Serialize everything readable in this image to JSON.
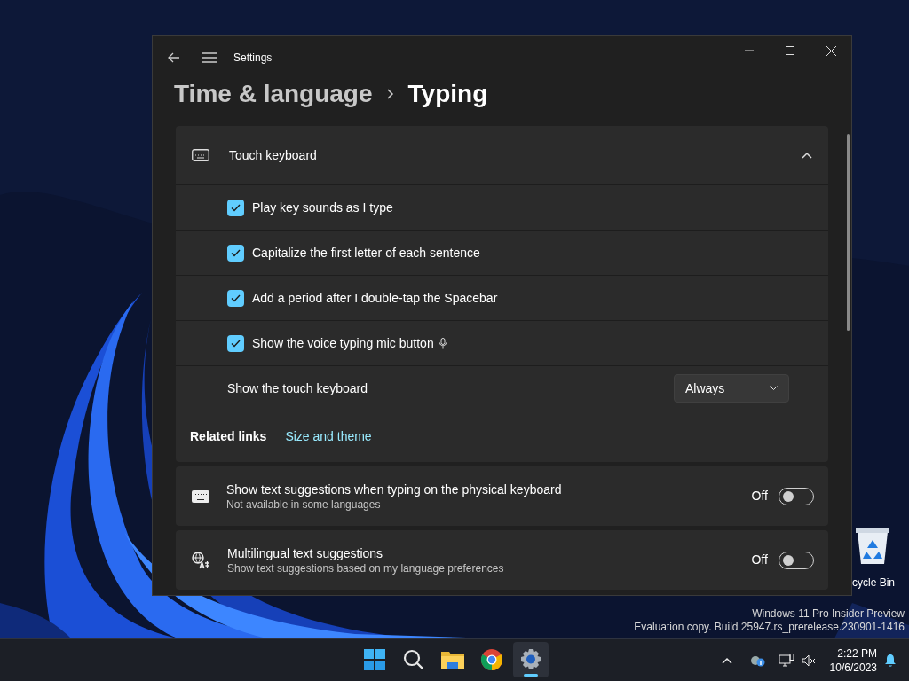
{
  "window": {
    "title": "Settings"
  },
  "breadcrumb": {
    "parent": "Time & language",
    "current": "Typing"
  },
  "touch_keyboard": {
    "title": "Touch keyboard",
    "expanded": true,
    "options": [
      {
        "kind": "checkbox",
        "label": "Play key sounds as I type",
        "checked": true
      },
      {
        "kind": "checkbox",
        "label": "Capitalize the first letter of each sentence",
        "checked": true
      },
      {
        "kind": "checkbox",
        "label": "Add a period after I double-tap the Spacebar",
        "checked": true
      },
      {
        "kind": "mic-checkbox",
        "label": "Show the voice typing mic button",
        "checked": true
      },
      {
        "kind": "dropdown",
        "label": "Show the touch keyboard",
        "value": "Always"
      }
    ],
    "related_links": {
      "label": "Related links",
      "links": [
        "Size and theme"
      ]
    }
  },
  "settings": [
    {
      "kind": "keyboard",
      "title": "Show text suggestions when typing on the physical keyboard",
      "description": "Not available in some languages",
      "state_label": "Off",
      "on": false
    },
    {
      "kind": "translate",
      "title": "Multilingual text suggestions",
      "description": "Show text suggestions based on my language preferences",
      "state_label": "Off",
      "on": false
    }
  ],
  "desktop": {
    "recycle_bin": "cycle Bin",
    "watermark": [
      "Windows 11 Pro Insider Preview",
      "Evaluation copy. Build 25947.rs_prerelease.230901-1416"
    ]
  },
  "taskbar": {
    "apps": [
      {
        "kind": "start",
        "selected": false
      },
      {
        "kind": "search",
        "selected": false
      },
      {
        "kind": "folder",
        "selected": false
      },
      {
        "kind": "browser",
        "selected": false
      },
      {
        "kind": "settings",
        "selected": true
      }
    ],
    "clock": {
      "time": "2:22 PM",
      "date": "10/6/2023"
    }
  }
}
